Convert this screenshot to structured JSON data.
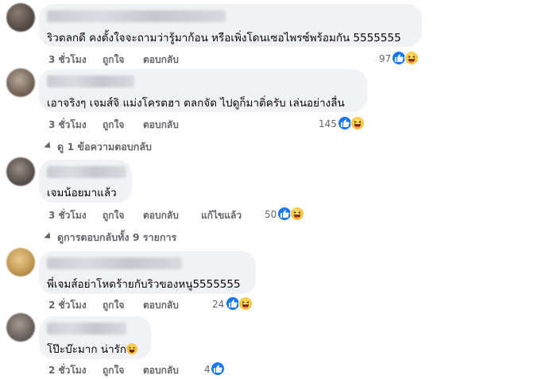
{
  "comments": [
    {
      "text": "ริวตลกดี คงตั้งใจจะถามว่ารู้มาก้อน หรือเพิ่งโดนเซอไพรซ์พร้อมกัน 5555555",
      "time": "3 ชั่วโมง",
      "like_label": "ถูกใจ",
      "reply_label": "ตอบกลับ",
      "edited": "",
      "reaction_count": "97"
    },
    {
      "text": "เอาจริงๆ เจมส์จิ แม่งโครตฮา ตลกจัด ไปดูก็มาติ่ครับ เล่นอย่างลื่น",
      "time": "3 ชั่วโมง",
      "like_label": "ถูกใจ",
      "reply_label": "ตอบกลับ",
      "edited": "",
      "reaction_count": "145"
    },
    {
      "text": "เจมน้อยมาแล้ว",
      "time": "3 ชั่วโมง",
      "like_label": "ถูกใจ",
      "reply_label": "ตอบกลับ",
      "edited": "แก้ไขแล้ว",
      "reaction_count": "50"
    },
    {
      "text": "พี่เจมส์อย่าโหดร้ายกับริวของหนู5555555",
      "time": "2 ชั่วโมง",
      "like_label": "ถูกใจ",
      "reply_label": "ตอบกลับ",
      "edited": "",
      "reaction_count": "24"
    },
    {
      "text": "โป๊ะบ๊ะมาก น่ารัก",
      "time": "2 ชั่วโมง",
      "like_label": "ถูกใจ",
      "reply_label": "ตอบกลับ",
      "edited": "",
      "reaction_count": "4"
    }
  ],
  "view_replies": [
    "ดู 1 ข้อความตอบกลับ",
    "ดูการตอบกลับทั้ง 9 รายการ"
  ],
  "icons": {
    "like": "thumbs-up-icon",
    "haha": "laughing-face-icon"
  },
  "colors": {
    "like_blue": "#1877f2",
    "bubble_bg": "#f0f2f5",
    "meta_gray": "#65676b"
  }
}
